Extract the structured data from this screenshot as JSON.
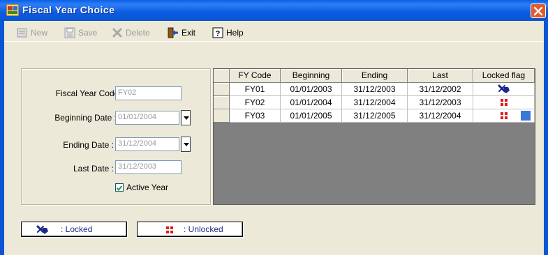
{
  "window": {
    "title": "Fiscal Year Choice",
    "accent": "#0a55d4",
    "close_color": "#e35a2b"
  },
  "toolbar": {
    "new_label": "New",
    "save_label": "Save",
    "delete_label": "Delete",
    "exit_label": "Exit",
    "help_label": "Help"
  },
  "form": {
    "fiscal_year_code_label": "Fiscal Year Code :",
    "fiscal_year_code_value": "FY02",
    "beginning_date_label": "Beginning Date :",
    "beginning_date_value": "01/01/2004",
    "ending_date_label": "Ending Date :",
    "ending_date_value": "31/12/2004",
    "last_date_label": "Last Date :",
    "last_date_value": "31/12/2003",
    "active_year_label": "Active Year",
    "active_year_checked": true
  },
  "grid": {
    "columns": [
      "FY Code",
      "Beginning",
      "Ending",
      "Last",
      "Locked flag"
    ],
    "rows": [
      {
        "code": "FY01",
        "beginning": "01/01/2003",
        "ending": "31/12/2003",
        "last": "31/12/2002",
        "flag": "locked"
      },
      {
        "code": "FY02",
        "beginning": "01/01/2004",
        "ending": "31/12/2004",
        "last": "31/12/2003",
        "flag": "unlocked"
      },
      {
        "code": "FY03",
        "beginning": "01/01/2005",
        "ending": "31/12/2005",
        "last": "31/12/2004",
        "flag": "unlocked"
      }
    ]
  },
  "legend": {
    "locked_label": ": Locked",
    "unlocked_label": ": Unlocked",
    "locked_icon": "locked-icon",
    "unlocked_icon": "unlocked-icon",
    "locked_color": "#1a2a8c",
    "unlocked_color": "#e01c1c"
  }
}
